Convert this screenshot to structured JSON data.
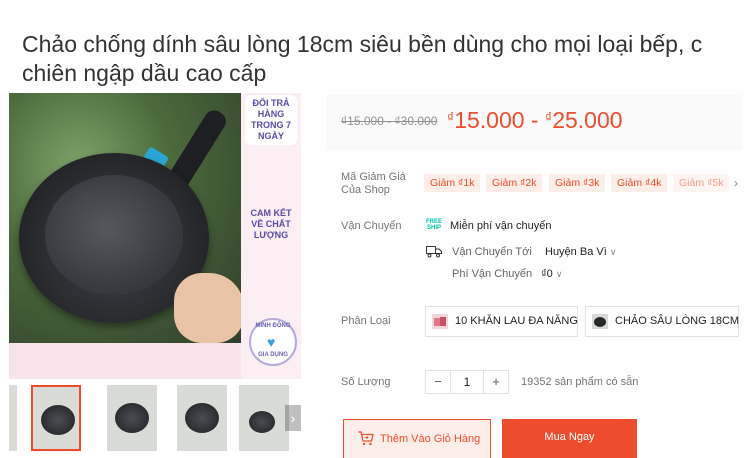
{
  "product": {
    "title_line1": "Chảo chống dính sâu lòng 18cm siêu bền dùng cho mọi loại bếp, c",
    "title_line2": "chiên ngập dầu cao cấp"
  },
  "gallery": {
    "badge_return": "ĐỔI TRẢ HÀNG TRONG 7 NGÀY",
    "badge_quality": "CAM KẾT VỀ CHẤT LƯỢNG",
    "seal_top": "MINH ĐÔNG",
    "seal_bottom": "GIA DỤNG",
    "thumbnails": [
      "thumb-1",
      "thumb-2",
      "thumb-3",
      "thumb-4",
      "thumb-5"
    ],
    "active_thumbnail": 1
  },
  "price": {
    "old_range": "₫15.000 - ₫30.000",
    "currency": "₫",
    "new_min": "15.000",
    "separator": " - ",
    "new_max": "25.000"
  },
  "vouchers": {
    "label": "Mã Giảm Giá Của Shop",
    "items": [
      "Giảm ₫1k",
      "Giảm ₫2k",
      "Giảm ₫3k",
      "Giảm ₫4k",
      "Giảm ₫5k"
    ],
    "more_icon": "chevron-right-icon"
  },
  "shipping": {
    "label": "Vận Chuyển",
    "free_text": "Miễn phí vận chuyển",
    "free_icon_text": "FREE SHIP",
    "to_label": "Vận Chuyển Tới",
    "to_value": "Huyện Ba Vì",
    "fee_label": "Phí Vận Chuyển",
    "fee_value": "₫0"
  },
  "variants": {
    "label": "Phân Loại",
    "options": [
      "10 KHĂN LAU ĐA NĂNG",
      "CHẢO SÂU LÒNG 18CM"
    ]
  },
  "quantity": {
    "label": "Số Lượng",
    "minus": "−",
    "value": "1",
    "plus": "+",
    "stock": "19352 sản phẩm có sẵn"
  },
  "actions": {
    "add_to_cart": "Thêm Vào Giỏ Hàng",
    "buy_now": "Mua Ngay"
  },
  "colors": {
    "accent": "#ee4d2d",
    "accent_light": "#fdeee9",
    "muted_text": "#757575"
  }
}
